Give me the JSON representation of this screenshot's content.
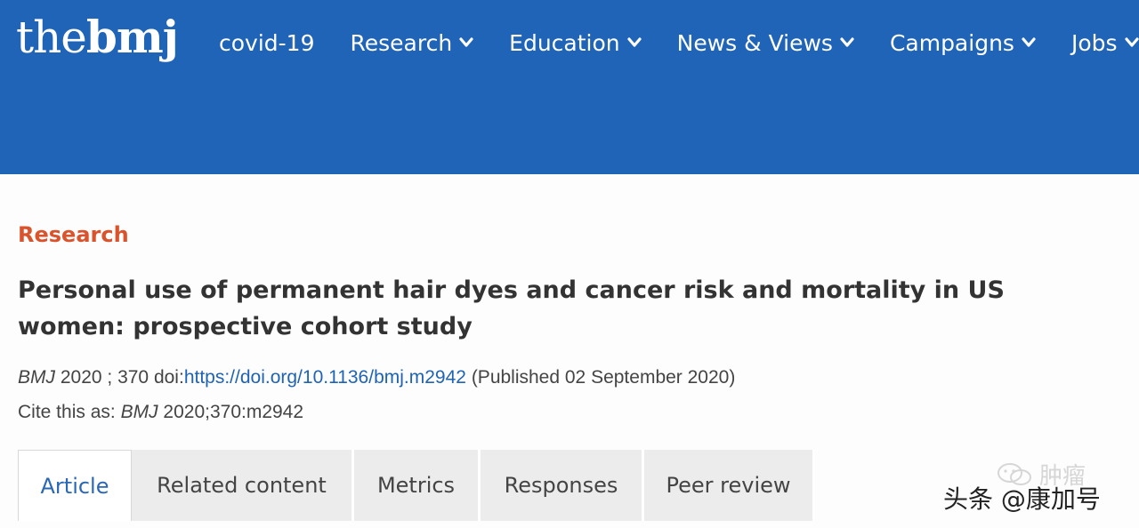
{
  "header": {
    "logo_the": "the",
    "logo_bmj": "bmj",
    "colors": {
      "bar": "#2064b8",
      "text": "#ffffff"
    },
    "nav": [
      {
        "label": "covid-19",
        "has_dropdown": false
      },
      {
        "label": "Research",
        "has_dropdown": true
      },
      {
        "label": "Education",
        "has_dropdown": true
      },
      {
        "label": "News & Views",
        "has_dropdown": true
      },
      {
        "label": "Campaigns",
        "has_dropdown": true
      },
      {
        "label": "Jobs",
        "has_dropdown": true
      }
    ]
  },
  "article": {
    "section": "Research",
    "section_color": "#d9532c",
    "title": "Personal use of permanent hair dyes and cancer risk and mortality in US women: prospective cohort study",
    "citation": {
      "journal": "BMJ",
      "year_volume": "2020 ; 370",
      "doi_label": "doi:",
      "doi_url": "https://doi.org/10.1136/bmj.m2942",
      "published": "(Published 02 September 2020)"
    },
    "cite_as": {
      "prefix": "Cite this as:",
      "journal": "BMJ",
      "ref": "2020;370:m2942"
    }
  },
  "tabs": [
    {
      "label": "Article",
      "active": true
    },
    {
      "label": "Related content",
      "active": false
    },
    {
      "label": "Metrics",
      "active": false
    },
    {
      "label": "Responses",
      "active": false
    },
    {
      "label": "Peer review",
      "active": false
    }
  ],
  "watermark": {
    "faint": "肿瘤",
    "main": "头条 @康加号"
  }
}
